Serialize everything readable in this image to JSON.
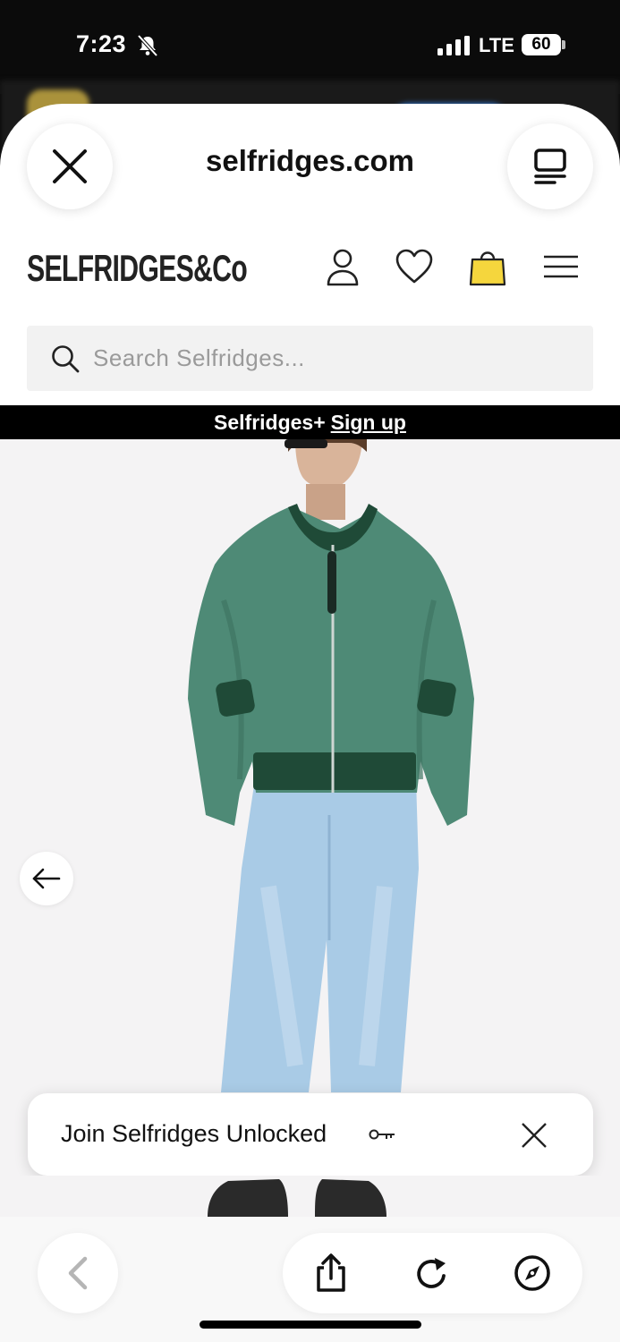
{
  "status_bar": {
    "time": "7:23",
    "network": "LTE",
    "battery": "60",
    "icons": [
      "bell-slash-icon",
      "signal-icon"
    ]
  },
  "browser": {
    "url": "selfridges.com",
    "close_icon": "close-icon",
    "reader_icon": "reader-mode-icon"
  },
  "site_header": {
    "logo": "SELFRIDGES&Co",
    "icons": [
      "account-icon",
      "heart-icon",
      "shopping-bag-icon",
      "menu-icon"
    ],
    "bag_color": "#f5d63d"
  },
  "search": {
    "placeholder": "Search Selfridges..."
  },
  "promo": {
    "text": "Selfridges+",
    "link": "Sign up"
  },
  "product": {
    "jacket_color": "#4e8a76",
    "jeans_color": "#a9cbe6"
  },
  "join_banner": {
    "text": "Join Selfridges Unlocked",
    "icon": "key-icon"
  },
  "toolbar": {
    "icons": [
      "back-chevron-icon",
      "share-icon",
      "reload-icon",
      "compass-icon"
    ]
  }
}
